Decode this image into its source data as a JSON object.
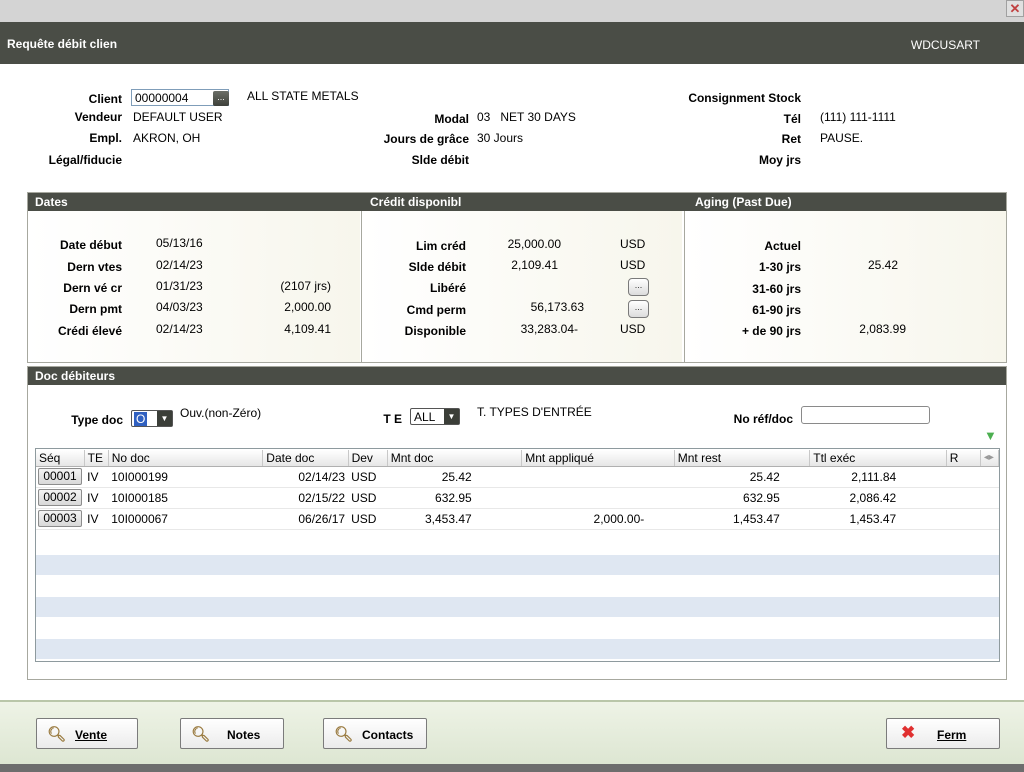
{
  "window": {
    "close_glyph": "✕"
  },
  "titlebar": {
    "title": "Requête débit clien",
    "code": "WDCUSART"
  },
  "header": {
    "client_label": "Client",
    "client_value": "00000004",
    "client_name": "ALL STATE METALS",
    "vendeur_label": "Vendeur",
    "vendeur_value": "DEFAULT USER",
    "empl_label": "Empl.",
    "empl_value": "AKRON, OH",
    "legal_label": "Légal/fiducie",
    "modal_label": "Modal",
    "modal_value": "03   NET 30 DAYS",
    "jours_label": "Jours de grâce",
    "jours_value": "30 Jours",
    "slde_label": "Slde débit",
    "consign_label": "Consignment Stock",
    "tel_label": "Tél",
    "tel_value": "(111) 111-1111",
    "ret_label": "Ret",
    "ret_value": "PAUSE.",
    "moy_label": "Moy jrs"
  },
  "dates": {
    "title": "Dates",
    "rows": [
      {
        "label": "Date début",
        "date": "05/13/16",
        "extra": ""
      },
      {
        "label": "Dern vtes",
        "date": "02/14/23",
        "extra": ""
      },
      {
        "label": "Dern vé cr",
        "date": "01/31/23",
        "extra": "(2107 jrs)"
      },
      {
        "label": "Dern pmt",
        "date": "04/03/23",
        "extra": "2,000.00"
      },
      {
        "label": "Crédi élevé",
        "date": "02/14/23",
        "extra": "4,109.41"
      }
    ]
  },
  "credit": {
    "title": "Crédit disponibl",
    "rows": [
      {
        "label": "Lim créd",
        "value": "25,000.00",
        "cur": "USD"
      },
      {
        "label": "Slde débit",
        "value": "2,109.41",
        "cur": "USD"
      },
      {
        "label": "Libéré",
        "value": "",
        "cur": ""
      },
      {
        "label": "Cmd perm",
        "value": "56,173.63",
        "cur": ""
      },
      {
        "label": "Disponible",
        "value": "33,283.04-",
        "cur": "USD"
      }
    ],
    "ellipsis": "..."
  },
  "aging": {
    "title": "Aging (Past Due)",
    "rows": [
      {
        "label": "Actuel",
        "value": ""
      },
      {
        "label": "1-30 jrs",
        "value": "25.42"
      },
      {
        "label": "31-60 jrs",
        "value": ""
      },
      {
        "label": "61-90 jrs",
        "value": ""
      },
      {
        "label": "+ de 90 jrs",
        "value": "2,083.99"
      }
    ]
  },
  "docs": {
    "title": "Doc débiteurs",
    "type_label": "Type doc",
    "type_value": "O",
    "type_desc": "Ouv.(non-Zéro)",
    "te_label": "T E",
    "te_value": "ALL",
    "te_desc": "T. TYPES D'ENTRÉE",
    "ref_label": "No réf/doc",
    "ref_value": "",
    "columns": [
      "Séq",
      "TE",
      "No doc",
      "Date doc",
      "Dev",
      "Mnt doc",
      "Mnt appliqué",
      "Mnt rest",
      "Ttl exéc",
      "R"
    ],
    "rows": [
      {
        "seq": "00001",
        "te": "IV",
        "nodoc": "10I000199",
        "date": "02/14/23",
        "dev": "USD",
        "mnt": "25.42",
        "applique": "",
        "rest": "25.42",
        "ttl": "2,111.84",
        "r": ""
      },
      {
        "seq": "00002",
        "te": "IV",
        "nodoc": "10I000185",
        "date": "02/15/22",
        "dev": "USD",
        "mnt": "632.95",
        "applique": "",
        "rest": "632.95",
        "ttl": "2,086.42",
        "r": ""
      },
      {
        "seq": "00003",
        "te": "IV",
        "nodoc": "10I000067",
        "date": "06/26/17",
        "dev": "USD",
        "mnt": "3,453.47",
        "applique": "2,000.00-",
        "rest": "1,453.47",
        "ttl": "1,453.47",
        "r": ""
      }
    ]
  },
  "footer": {
    "vente": "Vente",
    "notes": "Notes",
    "contacts": "Contacts",
    "ferm": "Ferm"
  },
  "colors": {
    "titlebar": "#4a4d46",
    "grid_stripe": "#dfe7f2",
    "footer": "#e4ebda"
  }
}
